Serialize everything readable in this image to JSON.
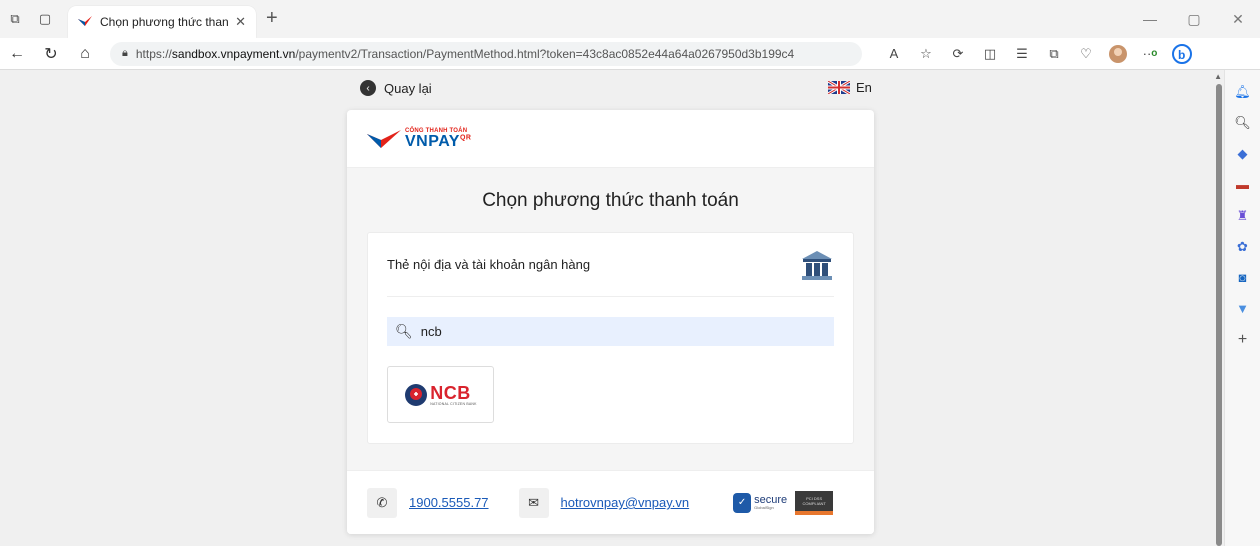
{
  "browser": {
    "tab_title": "Chọn phương thức thanh toán",
    "url_prefix": "https://",
    "url_host": "sandbox.vnpayment.vn",
    "url_path": "/paymentv2/Transaction/PaymentMethod.html?token=43c8ac0852e44a64a0267950d3b199c4",
    "copilot_badge": "o"
  },
  "page": {
    "back_label": "Quay lại",
    "lang_label": "En",
    "logo_small": "CỔNG THANH TOÁN",
    "logo_big": "VNPAY",
    "logo_sup": "QR",
    "heading": "Chọn phương thức thanh toán",
    "method_label": "Thẻ nội địa và tài khoản ngân hàng",
    "search_value": "ncb",
    "bank": {
      "name": "NCB",
      "subtitle": "NATIONAL CITIZEN BANK"
    }
  },
  "footer": {
    "phone": "1900.5555.77",
    "email": "hotrovnpay@vnpay.vn",
    "secure_label": "secure",
    "secure_sub": "GlobalSign",
    "pci_label": "PCI DSS COMPLIANT"
  },
  "colors": {
    "accent": "#005baa",
    "link": "#1a5ab8",
    "brand_red": "#e2231a"
  }
}
